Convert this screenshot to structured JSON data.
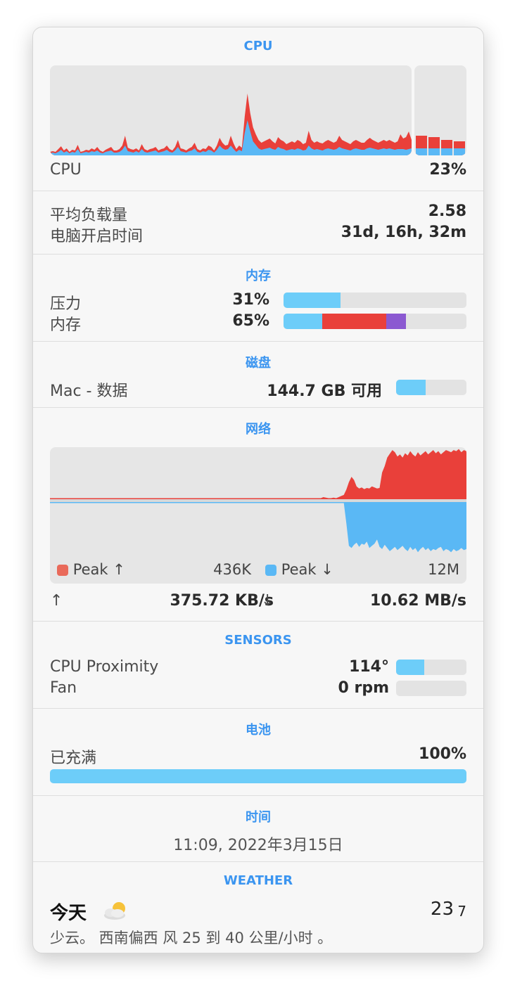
{
  "colors": {
    "accent": "#3b95f0",
    "red": "#e9403a",
    "blue": "#5ab8f5",
    "lightblue": "#6dcdf9",
    "purple": "#8b59d1"
  },
  "cpu": {
    "title": "CPU",
    "label": "CPU",
    "value": "23%",
    "history_user": [
      3,
      4,
      3,
      5,
      8,
      4,
      6,
      3,
      5,
      4,
      9,
      3,
      4,
      5,
      4,
      6,
      5,
      7,
      4,
      3,
      5,
      6,
      7,
      4,
      4,
      5,
      8,
      14,
      6,
      5,
      4,
      6,
      4,
      9,
      5,
      4,
      5,
      6,
      7,
      4,
      5,
      6,
      8,
      5,
      4,
      7,
      12,
      6,
      5,
      4,
      6,
      7,
      10,
      5,
      4,
      6,
      5,
      8,
      7,
      4,
      8,
      14,
      10,
      8,
      9,
      14,
      9,
      5,
      8,
      6,
      32,
      50,
      34,
      20,
      15,
      10,
      8,
      9,
      10,
      11,
      9,
      8,
      12,
      10,
      9,
      7,
      8,
      9,
      8,
      10,
      9,
      7,
      8,
      14,
      10,
      8,
      9,
      8,
      7,
      9,
      10,
      9,
      8,
      9,
      12,
      10,
      9,
      8,
      7,
      9,
      10,
      9,
      8,
      8,
      10,
      11,
      10,
      9,
      8,
      9,
      10,
      9,
      10,
      9,
      8,
      9,
      9,
      9,
      8,
      9,
      10
    ],
    "history_total": [
      5,
      6,
      5,
      9,
      13,
      7,
      10,
      5,
      8,
      7,
      15,
      5,
      6,
      8,
      7,
      10,
      8,
      12,
      7,
      5,
      8,
      10,
      12,
      7,
      7,
      9,
      14,
      28,
      11,
      9,
      8,
      10,
      7,
      16,
      9,
      7,
      9,
      10,
      12,
      7,
      9,
      10,
      14,
      9,
      7,
      12,
      22,
      10,
      9,
      7,
      10,
      12,
      18,
      9,
      7,
      10,
      9,
      14,
      12,
      7,
      14,
      25,
      18,
      14,
      15,
      28,
      17,
      9,
      14,
      11,
      55,
      88,
      60,
      40,
      30,
      22,
      18,
      20,
      22,
      24,
      20,
      17,
      26,
      22,
      20,
      16,
      18,
      20,
      18,
      22,
      20,
      16,
      18,
      35,
      22,
      18,
      20,
      18,
      17,
      20,
      22,
      20,
      18,
      20,
      28,
      22,
      20,
      18,
      16,
      20,
      22,
      20,
      18,
      18,
      22,
      25,
      22,
      20,
      18,
      20,
      22,
      20,
      22,
      20,
      18,
      20,
      30,
      24,
      26,
      34,
      22
    ],
    "cores": [
      {
        "total": 28,
        "user": 10
      },
      {
        "total": 26,
        "user": 10
      },
      {
        "total": 22,
        "user": 10
      },
      {
        "total": 20,
        "user": 10
      }
    ]
  },
  "system": {
    "load_label": "平均负载量",
    "load_value": "2.58",
    "uptime_label": "电脑开启时间",
    "uptime_value": "31d, 16h, 32m"
  },
  "memory": {
    "title": "内存",
    "pressure_label": "压力",
    "pressure_value": "31%",
    "pressure_fraction": 0.31,
    "memory_label": "内存",
    "memory_value": "65%",
    "memory_segments": [
      0.21,
      0.35,
      0.11
    ]
  },
  "disk": {
    "title": "磁盘",
    "label": "Mac - 数据",
    "value": "144.7 GB 可用",
    "used_fraction": 0.42
  },
  "network": {
    "title": "网络",
    "upload_history": [
      2,
      2,
      2,
      2,
      2,
      2,
      2,
      2,
      2,
      2,
      2,
      2,
      2,
      2,
      2,
      2,
      2,
      2,
      2,
      2,
      2,
      2,
      2,
      2,
      2,
      2,
      2,
      2,
      2,
      2,
      2,
      2,
      2,
      2,
      2,
      2,
      2,
      2,
      2,
      2,
      2,
      2,
      2,
      2,
      2,
      2,
      2,
      2,
      2,
      2,
      2,
      2,
      2,
      2,
      2,
      2,
      2,
      2,
      2,
      2,
      2,
      2,
      2,
      2,
      2,
      2,
      2,
      2,
      2,
      2,
      2,
      2,
      2,
      2,
      2,
      2,
      2,
      2,
      2,
      2,
      2,
      2,
      2,
      2,
      2,
      2,
      2,
      2,
      2,
      2,
      2,
      2,
      2,
      2,
      2,
      2,
      2,
      2,
      2,
      2,
      2,
      2,
      2,
      2,
      2,
      2,
      2,
      4,
      3,
      2,
      2,
      3,
      2,
      4,
      6,
      8,
      18,
      32,
      42,
      36,
      24,
      20,
      22,
      19,
      21,
      20,
      24,
      22,
      20,
      21,
      50,
      62,
      78,
      85,
      92,
      88,
      80,
      84,
      78,
      86,
      82,
      90,
      84,
      80,
      88,
      82,
      86,
      90,
      84,
      88,
      92,
      86,
      90,
      84,
      88,
      92,
      90,
      88,
      92,
      90,
      94,
      88,
      92,
      90
    ],
    "download_history": [
      2,
      2,
      2,
      2,
      2,
      2,
      2,
      2,
      2,
      2,
      2,
      2,
      2,
      2,
      2,
      2,
      2,
      2,
      2,
      2,
      2,
      2,
      2,
      2,
      2,
      2,
      2,
      2,
      2,
      2,
      2,
      2,
      2,
      2,
      2,
      2,
      2,
      2,
      2,
      2,
      2,
      2,
      2,
      2,
      2,
      2,
      2,
      2,
      2,
      2,
      2,
      2,
      2,
      2,
      2,
      2,
      2,
      2,
      2,
      2,
      2,
      2,
      2,
      2,
      2,
      2,
      2,
      2,
      2,
      2,
      2,
      2,
      2,
      2,
      2,
      2,
      2,
      2,
      2,
      2,
      2,
      2,
      2,
      2,
      2,
      2,
      2,
      2,
      2,
      2,
      2,
      2,
      2,
      2,
      2,
      2,
      2,
      2,
      2,
      2,
      2,
      2,
      2,
      2,
      2,
      2,
      2,
      2,
      2,
      2,
      2,
      2,
      2,
      2,
      2,
      2,
      40,
      82,
      86,
      80,
      76,
      84,
      78,
      80,
      74,
      86,
      82,
      78,
      70,
      84,
      88,
      80,
      86,
      92,
      88,
      84,
      90,
      86,
      82,
      88,
      92,
      84,
      90,
      86,
      94,
      88,
      84,
      90,
      86,
      92,
      88,
      90,
      86,
      84,
      92,
      88,
      90,
      94,
      88,
      92,
      90,
      86,
      90,
      88
    ],
    "peak_up_label": "Peak ↑",
    "peak_up_value": "436K",
    "peak_down_label": "Peak ↓",
    "peak_down_value": "12M",
    "up_arrow": "↑",
    "up_value": "375.72 KB/s",
    "down_arrow": "↓",
    "down_value": "10.62 MB/s"
  },
  "sensors": {
    "title": "SENSORS",
    "items": [
      {
        "label": "CPU Proximity",
        "value": "114°",
        "fraction": 0.4
      },
      {
        "label": "Fan",
        "value": "0 rpm",
        "fraction": 0.0
      }
    ]
  },
  "battery": {
    "title": "电池",
    "label": "已充满",
    "value": "100%",
    "fraction": 1.0
  },
  "time": {
    "title": "时间",
    "value": "11:09, 2022年3月15日"
  },
  "weather": {
    "title": "WEATHER",
    "day": "今天",
    "icon": "partly-cloudy-icon",
    "high": "23",
    "low": "7",
    "description": "少云。 西南偏西 风 25 到 40 公里/小时 。"
  }
}
